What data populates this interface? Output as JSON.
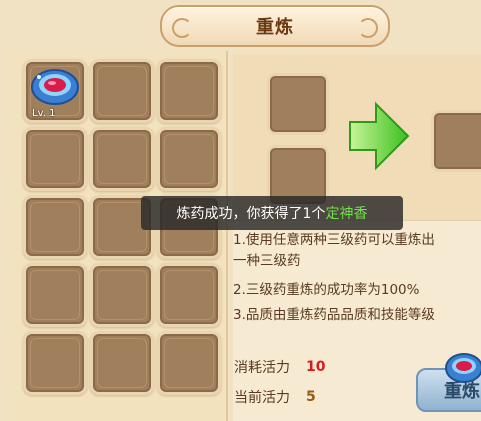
{
  "window": {
    "title": "重炼"
  },
  "inventory": {
    "slots": [
      {
        "item": "ring",
        "level": "Lv. 1"
      },
      {},
      {},
      {},
      {},
      {},
      {},
      {},
      {},
      {},
      {},
      {},
      {},
      {},
      {}
    ]
  },
  "craft": {
    "arrow_icon": "green-arrow-right-icon",
    "material_slots": 2,
    "result_slots": 1
  },
  "toast": {
    "prefix": "炼药成功，你获得了1个",
    "item_name": "定神香",
    "item_color": "#6fe04a"
  },
  "description": {
    "lines": [
      "1.使用任意两种三级药可以重炼出",
      "一种三级药",
      "2.三级药重炼的成功率为100%",
      "3.品质由重炼药品品质和技能等级"
    ]
  },
  "stats": {
    "cost_label": "消耗活力",
    "cost_value": "10",
    "current_label": "当前活力",
    "current_value": "5"
  },
  "button": {
    "label": "重炼"
  },
  "colors": {
    "title_text": "#6a3b12",
    "cost_value": "#d61c1c",
    "current_value": "#9a5a10",
    "toast_highlight": "#6fe04a"
  }
}
